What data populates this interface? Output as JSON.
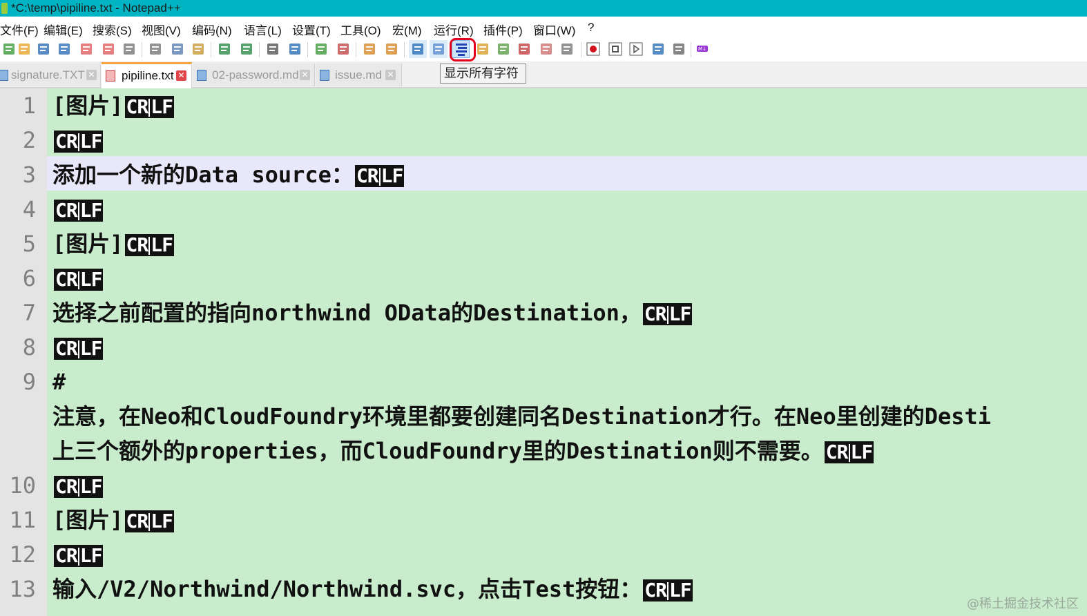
{
  "window": {
    "title": "*C:\\temp\\pipiline.txt - Notepad++"
  },
  "menu": [
    "文件(F)",
    "编辑(E)",
    "搜索(S)",
    "视图(V)",
    "编码(N)",
    "语言(L)",
    "设置(T)",
    "工具(O)",
    "宏(M)",
    "运行(R)",
    "插件(P)",
    "窗口(W)",
    "?"
  ],
  "toolbar": {
    "tooltip": "显示所有字符",
    "icons": [
      "new-file-icon",
      "open-file-icon",
      "save-icon",
      "save-all-icon",
      "close-icon",
      "close-all-icon",
      "print-icon",
      "cut-icon",
      "copy-icon",
      "paste-icon",
      "undo-icon",
      "redo-icon",
      "find-icon",
      "replace-icon",
      "zoom-in-icon",
      "zoom-out-icon",
      "sync-vertical-icon",
      "sync-horizontal-icon",
      "word-wrap-icon",
      "show-symbols-icon",
      "show-all-characters-icon",
      "indent-guide-icon",
      "doc-map-icon",
      "function-list-icon",
      "folder-workspace-icon",
      "monitor-icon",
      "record-macro-icon",
      "stop-record-icon",
      "play-macro-icon",
      "run-macro-multiple-icon",
      "save-macro-icon",
      "markdown-icon"
    ]
  },
  "tabs": [
    {
      "label": "signature.TXT",
      "active": false
    },
    {
      "label": "pipiline.txt",
      "active": true
    },
    {
      "label": "02-password.md",
      "active": false
    },
    {
      "label": "issue.md",
      "active": false
    }
  ],
  "editor": {
    "eol_marker": {
      "cr": "CR",
      "lf": "LF"
    },
    "current_line": 3,
    "lines": [
      {
        "num": "1",
        "text": "[图片]"
      },
      {
        "num": "2",
        "text": ""
      },
      {
        "num": "3",
        "text": "添加一个新的Data source："
      },
      {
        "num": "4",
        "text": ""
      },
      {
        "num": "5",
        "text": "[图片]"
      },
      {
        "num": "6",
        "text": ""
      },
      {
        "num": "7",
        "text": "选择之前配置的指向northwind OData的Destination，"
      },
      {
        "num": "8",
        "text": ""
      },
      {
        "num": "9",
        "text": "#",
        "no_eol": true
      },
      {
        "num": "",
        "text": "注意，在Neo和CloudFoundry环境里都要创建同名Destination才行。在Neo里创建的Desti",
        "no_eol": true
      },
      {
        "num": "",
        "text": "上三个额外的properties，而CloudFoundry里的Destination则不需要。"
      },
      {
        "num": "10",
        "text": ""
      },
      {
        "num": "11",
        "text": "[图片]"
      },
      {
        "num": "12",
        "text": ""
      },
      {
        "num": "13",
        "text": "输入/V2/Northwind/Northwind.svc，点击Test按钮："
      }
    ]
  },
  "watermark": "@稀土掘金技术社区"
}
